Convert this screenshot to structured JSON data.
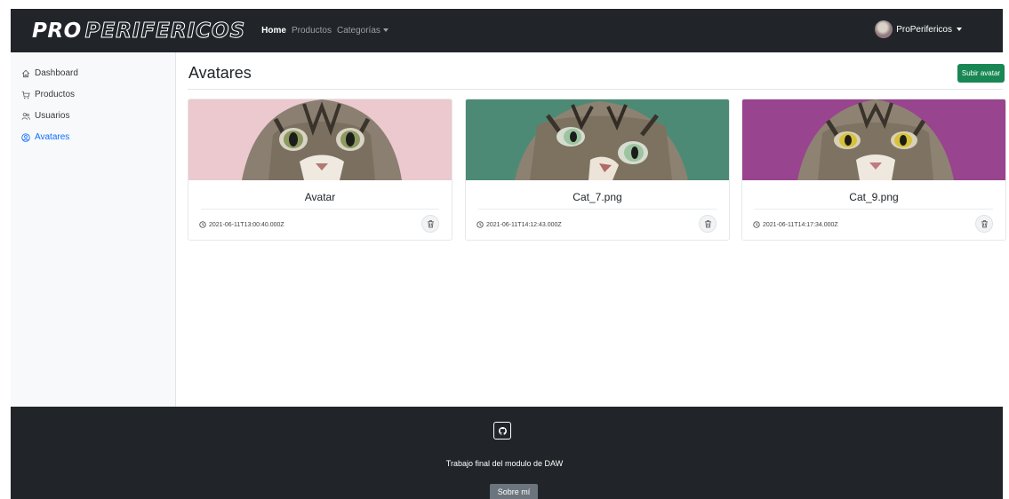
{
  "navbar": {
    "brand_bold": "PRO",
    "brand_outline": "PERIFERICOS",
    "links": [
      {
        "label": "Home",
        "active": true
      },
      {
        "label": "Productos",
        "active": false
      },
      {
        "label": "Categorías",
        "active": false,
        "dropdown": true
      }
    ],
    "user": {
      "name": "ProPerifericos",
      "avatar_icon": "cat-avatar-icon"
    }
  },
  "sidebar": {
    "items": [
      {
        "label": "Dashboard",
        "icon": "home-icon",
        "active": false
      },
      {
        "label": "Productos",
        "icon": "cart-icon",
        "active": false
      },
      {
        "label": "Usuarios",
        "icon": "users-icon",
        "active": false
      },
      {
        "label": "Avatares",
        "icon": "user-circle-icon",
        "active": true
      }
    ],
    "active_color": "#0d6efd"
  },
  "main": {
    "title": "Avatares",
    "upload_label": "Subir avatar",
    "upload_color": "#198754",
    "cards": [
      {
        "title": "Avatar",
        "date": "2021-06-11T13:00:40.000Z",
        "bg_color": "#ecc8cf"
      },
      {
        "title": "Cat_7.png",
        "date": "2021-06-11T14:12:43.000Z",
        "bg_color": "#4d8a76"
      },
      {
        "title": "Cat_9.png",
        "date": "2021-06-11T14:17:34.000Z",
        "bg_color": "#99448f"
      }
    ]
  },
  "footer": {
    "github_icon": "github-icon",
    "text": "Trabajo final del modulo de DAW",
    "about_label": "Sobre mí",
    "bg_color": "#212529"
  }
}
